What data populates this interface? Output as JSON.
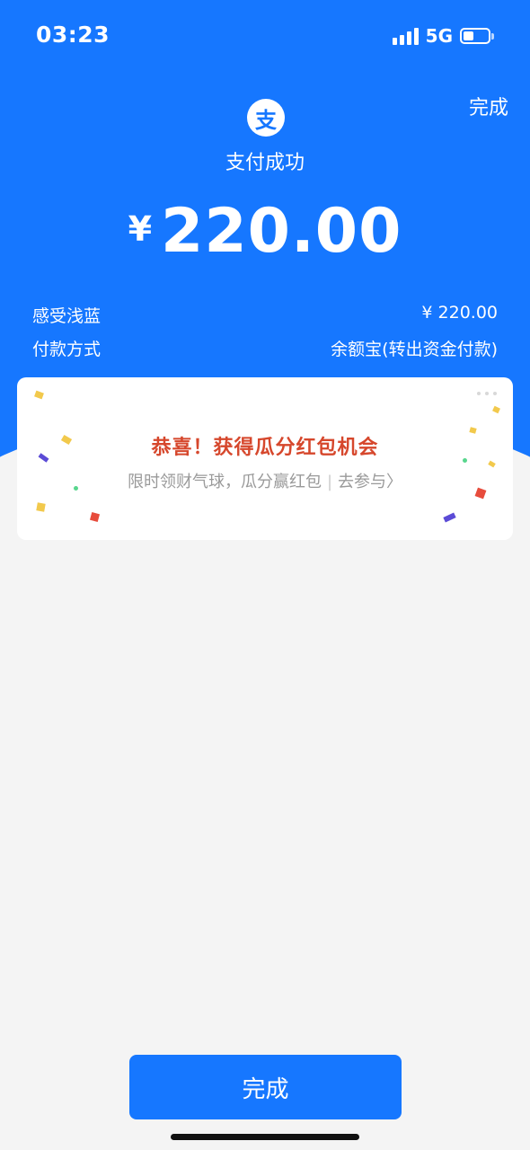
{
  "status_bar": {
    "time": "03:23",
    "network": "5G"
  },
  "header": {
    "done_link": "完成",
    "logo_glyph": "支",
    "status_text": "支付成功",
    "currency_symbol": "¥",
    "amount": "220.00"
  },
  "details": [
    {
      "label": "感受浅蓝",
      "value": "¥ 220.00"
    },
    {
      "label": "付款方式",
      "value": "余额宝(转出资金付款)"
    }
  ],
  "promo": {
    "title": "恭喜！获得瓜分红包机会",
    "subtitle": "限时领财气球，瓜分赢红包",
    "separator": "|",
    "action": "去参与",
    "action_chevron": "〉"
  },
  "footer": {
    "done_button": "完成"
  },
  "colors": {
    "brand_blue": "#1677ff",
    "promo_red": "#d6472c",
    "background": "#f4f4f4"
  },
  "icons": [
    "alipay-logo-icon",
    "signal-icon",
    "battery-icon",
    "chevron-right-icon"
  ]
}
